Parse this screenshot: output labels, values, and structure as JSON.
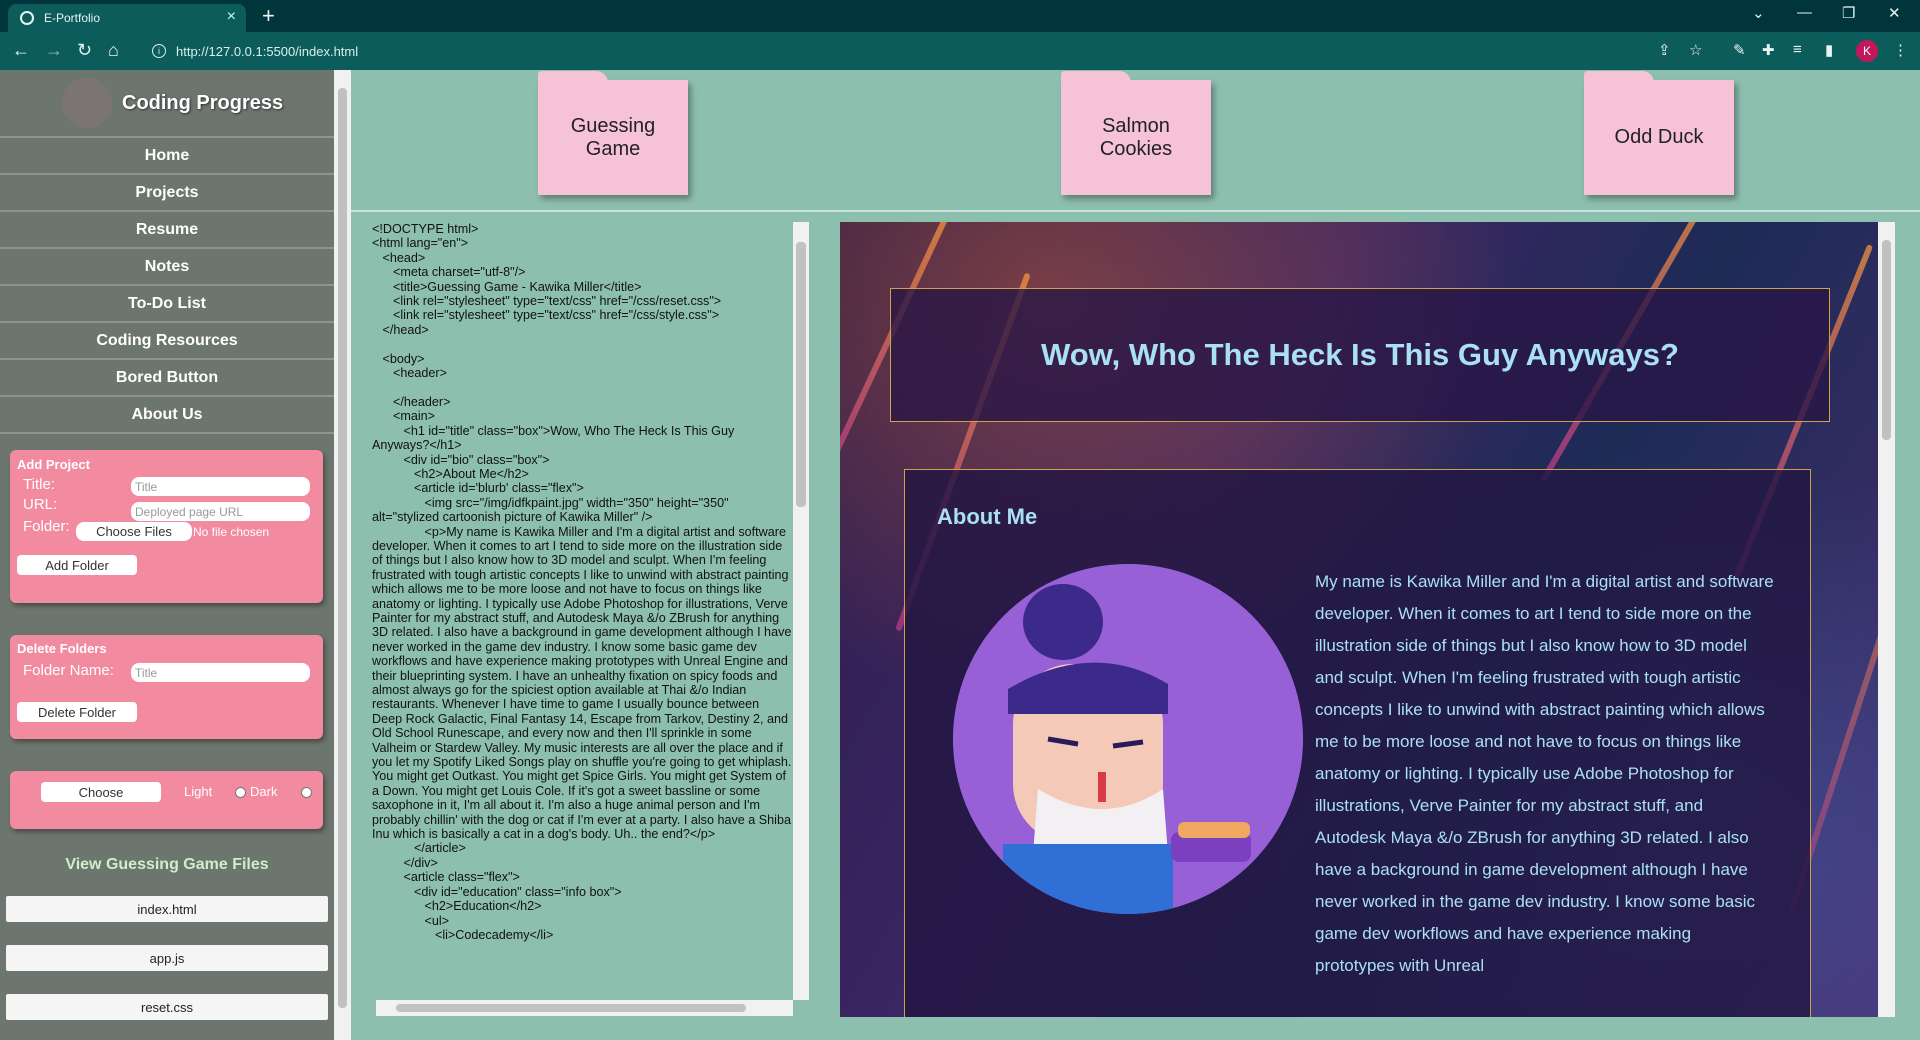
{
  "browser": {
    "tab_title": "E-Portfolio",
    "tab_close": "×",
    "new_tab": "+",
    "url": "http://127.0.0.1:5500/index.html",
    "profile_initial": "K",
    "window_controls": [
      "⌄",
      "—",
      "❐",
      "✕"
    ]
  },
  "sidebar": {
    "brand_title": "Coding Progress",
    "nav": [
      "Home",
      "Projects",
      "Resume",
      "Notes",
      "To-Do List",
      "Coding Resources",
      "Bored Button",
      "About Us"
    ],
    "add_project": {
      "title": "Add Project",
      "title_label": "Title:",
      "title_placeholder": "Title",
      "url_label": "URL:",
      "url_placeholder": "Deployed page URL",
      "folder_label": "Folder:",
      "choose_files": "Choose Files",
      "no_file": "No file chosen",
      "add_button": "Add Folder"
    },
    "delete_folders": {
      "title": "Delete Folders",
      "name_label": "Folder Name:",
      "name_placeholder": "Title",
      "delete_button": "Delete Folder"
    },
    "theme": {
      "choose_button": "Choose",
      "light_label": "Light",
      "dark_label": "Dark"
    },
    "files_title": "View Guessing Game Files",
    "files": [
      "index.html",
      "app.js",
      "reset.css"
    ]
  },
  "folders": [
    "Guessing\nGame",
    "Salmon\nCookies",
    "Odd Duck"
  ],
  "code_source": "<!DOCTYPE html>\n<html lang=\"en\">\n   <head>\n      <meta charset=\"utf-8\"/>\n      <title>Guessing Game - Kawika Miller</title>\n      <link rel=\"stylesheet\" type=\"text/css\" href=\"/css/reset.css\">\n      <link rel=\"stylesheet\" type=\"text/css\" href=\"/css/style.css\">\n   </head>\n\n   <body>\n      <header>\n\n      </header>\n      <main>\n         <h1 id=\"title\" class=\"box\">Wow, Who The Heck Is This Guy Anyways?</h1>\n         <div id=\"bio\" class=\"box\">\n            <h2>About Me</h2>\n            <article id='blurb' class=\"flex\">\n               <img src=\"/img/idfkpaint.jpg\" width=\"350\" height=\"350\" alt=\"stylized cartoonish picture of Kawika Miller\" />\n               <p>My name is Kawika Miller and I'm a digital artist and software developer. When it comes to art I tend to side more on the illustration side of things but I also know how to 3D model and sculpt. When I'm feeling frustrated with tough artistic concepts I like to unwind with abstract painting which allows me to be more loose and not have to focus on things like anatomy or lighting. I typically use Adobe Photoshop for illustrations, Verve Painter for my abstract stuff, and Autodesk Maya &/o ZBrush for anything 3D related. I also have a background in game development although I have never worked in the game dev industry. I know some basic game dev workflows and have experience making prototypes with Unreal Engine and their blueprinting system. I have an unhealthy fixation on spicy foods and almost always go for the spiciest option available at Thai &/o Indian restaurants. Whenever I have time to game I usually bounce between Deep Rock Galactic, Final Fantasy 14, Escape from Tarkov, Destiny 2, and Old School Runescape, and every now and then I'll sprinkle in some Valheim or Stardew Valley. My music interests are all over the place and if you let my Spotify Liked Songs play on shuffle you're going to get whiplash. You might get Outkast. You might get Spice Girls. You might get System of a Down. You might get Louis Cole. If it's got a sweet bassline or some saxophone in it, I'm all about it. I'm also a huge animal person and I'm probably chillin' with the dog or cat if I'm ever at a party. I also have a Shiba Inu which is basically a cat in a dog's body. Uh.. the end?</p>\n            </article>\n         </div>\n         <article class=\"flex\">\n            <div id=\"education\" class=\"info box\">\n               <h2>Education</h2>\n               <ul>\n                  <li>Codecademy</li>",
  "preview": {
    "title": "Wow, Who The Heck Is This Guy Anyways?",
    "about_heading": "About Me",
    "bio": "My name is Kawika Miller and I'm a digital artist and software developer. When it comes to art I tend to side more on the illustration side of things but I also know how to 3D model and sculpt. When I'm feeling frustrated with tough artistic concepts I like to unwind with abstract painting which allows me to be more loose and not have to focus on things like anatomy or lighting. I typically use Adobe Photoshop for illustrations, Verve Painter for my abstract stuff, and Autodesk Maya &/o ZBrush for anything 3D related. I also have a background in game development although I have never worked in the game dev industry. I know some basic game dev workflows and have experience making prototypes with Unreal"
  },
  "colors": {
    "page_bg": "#8dbfaf",
    "sidebar_bg": "#6d756f",
    "card_pink": "#f28ba0",
    "folder_pink": "#f6c2d8",
    "title_cyan": "#a9e0f2",
    "chrome_dark": "#01353c",
    "chrome_teal": "#0c5c5c"
  }
}
